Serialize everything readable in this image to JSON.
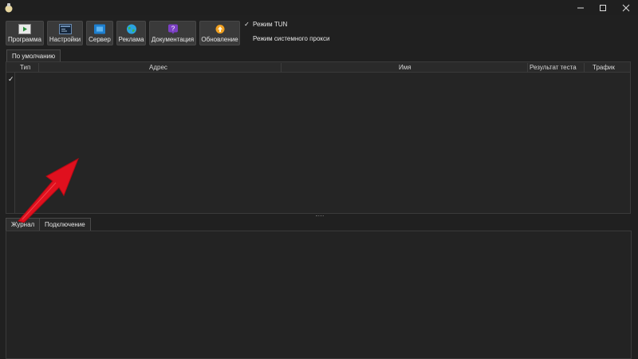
{
  "titlebar": {
    "icons": [
      "app-icon",
      "minimize-icon",
      "maximize-icon",
      "close-icon"
    ]
  },
  "toolbar": {
    "buttons": [
      {
        "label": "Программа",
        "icon": "program-play-icon",
        "color": "#2a8f3e"
      },
      {
        "label": "Настройки",
        "icon": "settings-window-icon",
        "color": "#2d4a6b"
      },
      {
        "label": "Сервер",
        "icon": "server-icon",
        "color": "#1e7fcf"
      },
      {
        "label": "Реклама",
        "icon": "globe-icon",
        "color": "#2aa3e0"
      },
      {
        "label": "Документация",
        "icon": "help-question-icon",
        "color": "#7b3fc4"
      },
      {
        "label": "Обновление",
        "icon": "update-icon",
        "color": "#f0a020"
      }
    ],
    "toggles": [
      {
        "label": "Режим TUN",
        "checked": true
      },
      {
        "label": "Режим системного прокси",
        "checked": false
      }
    ]
  },
  "profile_tab": {
    "label": "По умолчанию"
  },
  "server_table": {
    "columns": [
      "Тип",
      "Адрес",
      "Имя",
      "Результат теста",
      "Трафик"
    ],
    "check_mark": "✓",
    "rows": []
  },
  "bottom_tabs": [
    {
      "label": "Журнал",
      "active": true
    },
    {
      "label": "Подключение",
      "active": false
    }
  ],
  "annotation": {
    "color": "#e0101e",
    "icon": "red-arrow-pointer"
  }
}
